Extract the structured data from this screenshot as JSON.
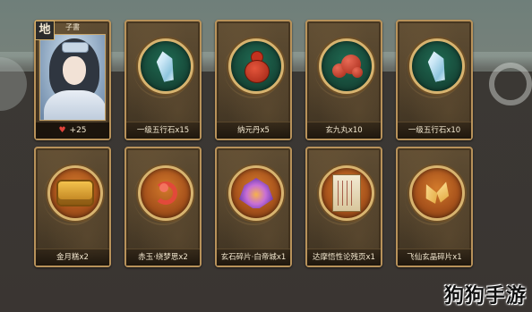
{
  "hero": {
    "tier": "地",
    "name": "子書",
    "stat_value": "+25"
  },
  "row1": [
    {
      "label": "一级五行石x15",
      "icon": "crystal-icon"
    },
    {
      "label": "纳元丹x5",
      "icon": "gourd-icon"
    },
    {
      "label": "玄九丸x10",
      "icon": "pills-icon"
    },
    {
      "label": "一级五行石x10",
      "icon": "crystal-icon"
    }
  ],
  "row2": [
    {
      "label": "金月糕x2",
      "icon": "ingot-icon"
    },
    {
      "label": "赤玉·绕梦思x2",
      "icon": "bird-icon"
    },
    {
      "label": "玄石碎片·白帝城x1",
      "icon": "phoenix-icon"
    },
    {
      "label": "达摩悟性论残页x1",
      "icon": "scroll-icon"
    },
    {
      "label": "飞仙玄晶碎片x1",
      "icon": "shards-icon"
    }
  ],
  "watermark": "狗狗手游",
  "colors": {
    "card_border": "#b8925a",
    "label_text": "#f2e7cf",
    "medal_green": "#184d3c",
    "medal_orange": "#a8531c",
    "heart": "#e0433a"
  }
}
